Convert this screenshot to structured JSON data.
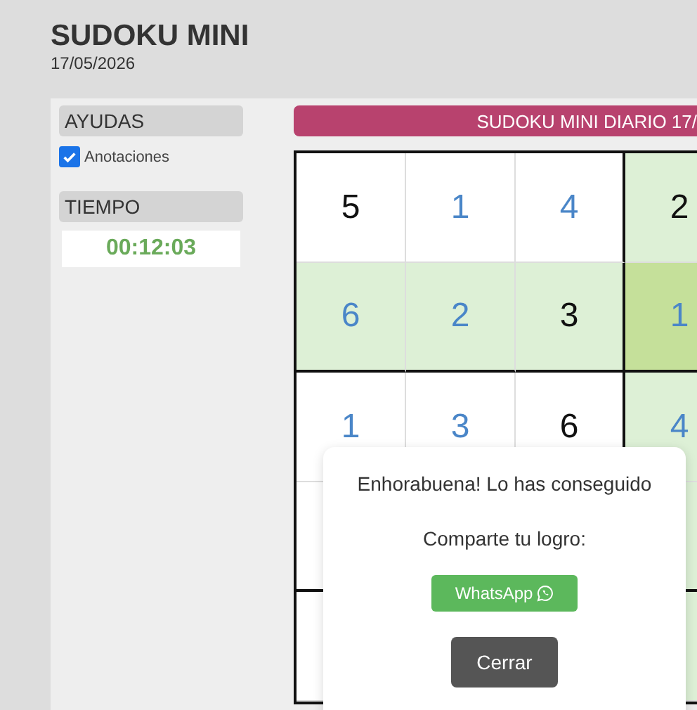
{
  "header": {
    "title": "SUDOKU MINI",
    "date": "17/05/2026"
  },
  "sidebar": {
    "aids_label": "AYUDAS",
    "notes": {
      "label": "Anotaciones",
      "checked": true
    },
    "time_label": "TIEMPO",
    "time": "00:12:03"
  },
  "banner": "SUDOKU MINI DIARIO 17/",
  "board": {
    "rows": [
      [
        {
          "value": "5",
          "given": true,
          "highlighted": false,
          "selected": false
        },
        {
          "value": "1",
          "given": false,
          "highlighted": false,
          "selected": false
        },
        {
          "value": "4",
          "given": false,
          "highlighted": false,
          "selected": false
        },
        {
          "value": "2",
          "given": true,
          "highlighted": true,
          "selected": false
        }
      ],
      [
        {
          "value": "6",
          "given": false,
          "highlighted": true,
          "selected": false
        },
        {
          "value": "2",
          "given": false,
          "highlighted": true,
          "selected": false
        },
        {
          "value": "3",
          "given": true,
          "highlighted": true,
          "selected": false
        },
        {
          "value": "1",
          "given": false,
          "highlighted": true,
          "selected": true
        }
      ],
      [
        {
          "value": "1",
          "given": false,
          "highlighted": false,
          "selected": false
        },
        {
          "value": "3",
          "given": false,
          "highlighted": false,
          "selected": false
        },
        {
          "value": "6",
          "given": true,
          "highlighted": false,
          "selected": false
        },
        {
          "value": "4",
          "given": false,
          "highlighted": true,
          "selected": false
        }
      ],
      [
        {
          "highlighted": false
        },
        {},
        {},
        {
          "highlighted": true
        }
      ],
      [
        {
          "highlighted": false
        },
        {},
        {},
        {
          "highlighted": true
        }
      ]
    ]
  },
  "dialog": {
    "message": "Enhorabuena! Lo has conseguido",
    "share_label": "Comparte tu logro:",
    "share_button": "WhatsApp",
    "close_button": "Cerrar"
  }
}
